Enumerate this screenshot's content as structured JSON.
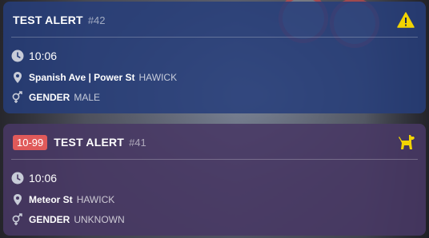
{
  "alerts": [
    {
      "title": "TEST ALERT",
      "number": "#42",
      "code": "",
      "icon": "warning-icon",
      "time": "10:06",
      "street": "Spanish Ave | Power St",
      "area": "HAWICK",
      "gender_label": "GENDER",
      "gender_value": "MALE"
    },
    {
      "title": "TEST ALERT",
      "number": "#41",
      "code": "10-99",
      "icon": "dog-icon",
      "time": "10:06",
      "street": "Meteor St",
      "area": "HAWICK",
      "gender_label": "GENDER",
      "gender_value": "UNKNOWN"
    }
  ],
  "colors": {
    "alert1_bg": "#263e7a",
    "alert2_bg": "#483864",
    "badge": "#e05a5a",
    "icon_yellow": "#f2d400"
  }
}
